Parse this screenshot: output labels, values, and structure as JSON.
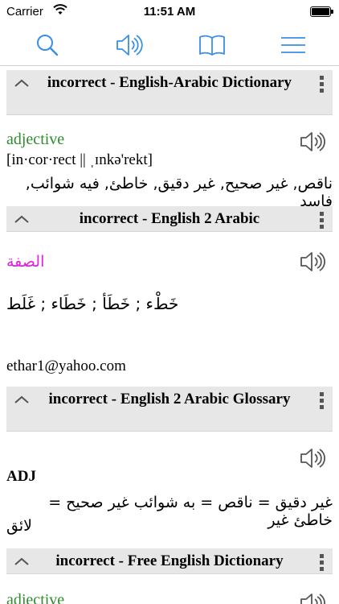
{
  "status_bar": {
    "carrier": "Carrier",
    "time": "11:51 AM"
  },
  "toolbar": {
    "icons": [
      "search-icon",
      "speaker-icon",
      "book-icon",
      "hamburger-menu-icon"
    ],
    "accent": "#3a8ee6"
  },
  "sections": [
    {
      "title": "incorrect - English-Arabic Dictionary",
      "part_of_speech": "adjective",
      "pronunciation": "[in·cor·rect || ˌɪnkə'rekt]",
      "translation": "ناقص, غير صحيح, غير دقيق, خاطئ, فيه شوائب, فاسد"
    },
    {
      "title": "incorrect - English 2 Arabic",
      "part_of_speech": "الصفة",
      "translation": "خَطْء ; خَطَأ ; خَطَاء ; غَلَط",
      "contributor": "ethar1@yahoo.com"
    },
    {
      "title": "incorrect - English 2 Arabic Glossary",
      "part_of_speech": "ADJ",
      "translation_line1": "غير دقيق = ناقص = به شوائب غير صحيح = خاطئ غير",
      "translation_line2": "لائق"
    },
    {
      "title": "incorrect - Free English Dictionary",
      "part_of_speech": "adjective"
    }
  ],
  "colors": {
    "header_bg": "#e7e7e7",
    "pos_green": "#2e8b2e",
    "pos_magenta": "#e11fe1"
  }
}
